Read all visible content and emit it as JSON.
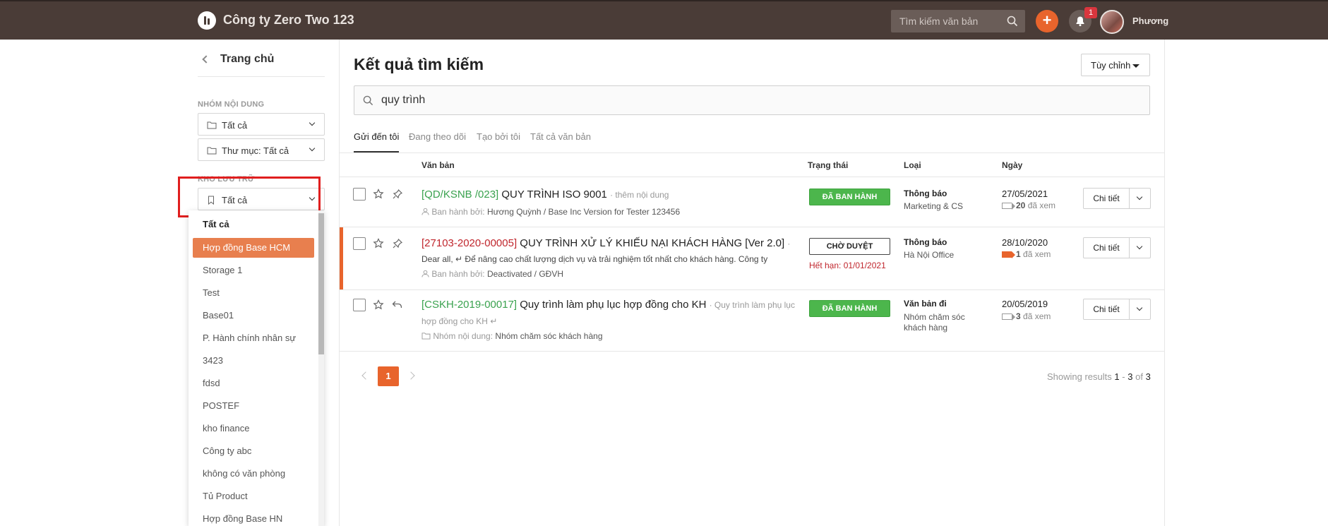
{
  "header": {
    "company": "Công ty Zero Two 123",
    "search_placeholder": "Tìm kiếm văn bản",
    "notification_count": "1",
    "user_name": "Phương"
  },
  "sidebar": {
    "back_label": "Trang chủ",
    "group_label": "NHÓM NỘI DUNG",
    "group_select": "Tất cả",
    "folder_select": "Thư mục: Tất cả",
    "storage_label": "KHO LƯU TRỮ",
    "storage_select": "Tất cả",
    "dropdown_items": [
      "Tất cả",
      "Hợp đồng Base HCM",
      "Storage 1",
      "Test",
      "Base01",
      "P. Hành chính nhân sự",
      "3423",
      "fdsd",
      "POSTEF",
      "kho finance",
      "Công ty abc",
      "không có văn phòng",
      "Tủ Product",
      "Hợp đồng Base HN"
    ],
    "dropdown_active_index": 1
  },
  "main": {
    "title": "Kết quả tìm kiếm",
    "customize_label": "Tùy chỉnh",
    "search_value": "quy trình",
    "tabs": [
      "Gửi đến tôi",
      "Đang theo dõi",
      "Tạo bởi tôi",
      "Tất cả văn bản"
    ],
    "columns": {
      "doc": "Văn bản",
      "status": "Trạng thái",
      "type": "Loại",
      "date": "Ngày"
    },
    "rows": [
      {
        "code": "[QD/KSNB /023]",
        "title": "QUY TRÌNH ISO 9001",
        "note": "· thêm nội dung",
        "issued_label": "Ban hành bởi:",
        "issued_by": "Hương Quỳnh / Base Inc Version for Tester 123456",
        "status": "ĐÃ BAN HÀNH",
        "type": "Thông báo",
        "type_sub": "Marketing & CS",
        "date": "27/05/2021",
        "views_num": "20",
        "views_label": "đã xem",
        "detail": "Chi tiết"
      },
      {
        "code": "[27103-2020-00005]",
        "title": "QUY TRÌNH XỬ LÝ KHIẾU NẠI KHÁCH HÀNG [Ver 2.0]",
        "note": "·",
        "desc": "Dear all, ↵ Để nâng cao chất lượng dịch vụ và trải nghiệm tốt nhất cho khách hàng. Công ty",
        "issued_label": "Ban hành bởi:",
        "issued_by": "Deactivated / GĐVH",
        "status": "CHỜ DUYỆT",
        "expire": "Hết hạn: 01/01/2021",
        "type": "Thông báo",
        "type_sub": "Hà Nội Office",
        "date": "28/10/2020",
        "views_num": "1",
        "views_label": "đã xem",
        "detail": "Chi tiết"
      },
      {
        "code": "[CSKH-2019-00017]",
        "title": "Quy trình làm phụ lục hợp đồng cho KH",
        "note": "· Quy trình làm phụ lục",
        "note2": "hợp đồng cho KH ↵",
        "group_label": "Nhóm nội dung:",
        "group_value": "Nhóm chăm sóc khách hàng",
        "status": "ĐÃ BAN HÀNH",
        "type": "Văn bản đi",
        "type_sub": "Nhóm chăm sóc khách hàng",
        "date": "20/05/2019",
        "views_num": "3",
        "views_label": "đã xem",
        "detail": "Chi tiết"
      }
    ],
    "pagination": {
      "current": "1",
      "results_prefix": "Showing results",
      "from": "1",
      "dash": "-",
      "to": "3",
      "of": "of",
      "total": "3"
    }
  },
  "colors": {
    "header_bg": "#4a3c37",
    "accent": "#e8642c",
    "published": "#4cb64c",
    "code_green": "#3aa24f",
    "code_red": "#c0262d",
    "highlight": "#e01e1e"
  }
}
